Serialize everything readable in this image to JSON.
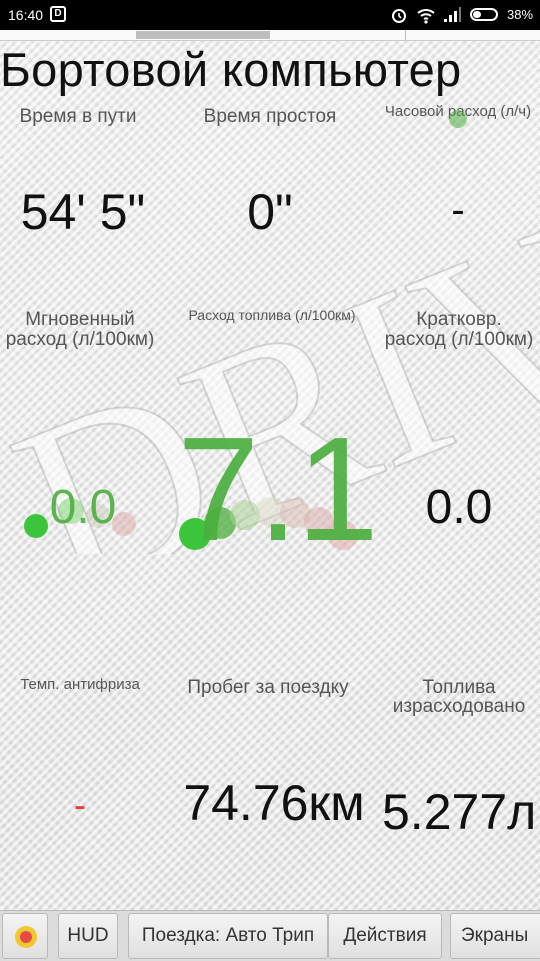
{
  "status_bar": {
    "time": "16:40",
    "app_icon_letter": "D",
    "battery_percent": "38%",
    "battery_level": 0.38
  },
  "title": "Бортовой компьютер",
  "watermark": "DRIVE",
  "cells": {
    "travel_time": {
      "label": "Время в пути",
      "value": "54' 5\""
    },
    "idle_time": {
      "label": "Время простоя",
      "value": "0\""
    },
    "hourly_consumption": {
      "label": "Часовой расход (л/ч)",
      "value": "-"
    },
    "instant_consumption": {
      "label_line1": "Мгновенный",
      "label_line2": "расход (л/100км)",
      "value": "0.0"
    },
    "fuel_consumption": {
      "label": "Расход топлива (л/100км)",
      "value": "7.1"
    },
    "short_term_consumption": {
      "label_line1": "Кратковр.",
      "label_line2": "расход (л/100км)",
      "value": "0.0"
    },
    "coolant_temp": {
      "label": "Темп. антифриза",
      "value": "-"
    },
    "trip_mileage": {
      "label": "Пробег за поездку",
      "value": "74.76км"
    },
    "fuel_used": {
      "label_line1": "Топлива",
      "label_line2": "израсходовано",
      "value": "5.277л"
    }
  },
  "colors": {
    "accent_green": "#4caf3f",
    "dash_red": "#e33b3b"
  },
  "bottom_bar": {
    "record_icon": "record-icon",
    "hud": "HUD",
    "trip": "Поездка: Авто Трип",
    "actions": "Действия",
    "screens": "Экраны"
  }
}
